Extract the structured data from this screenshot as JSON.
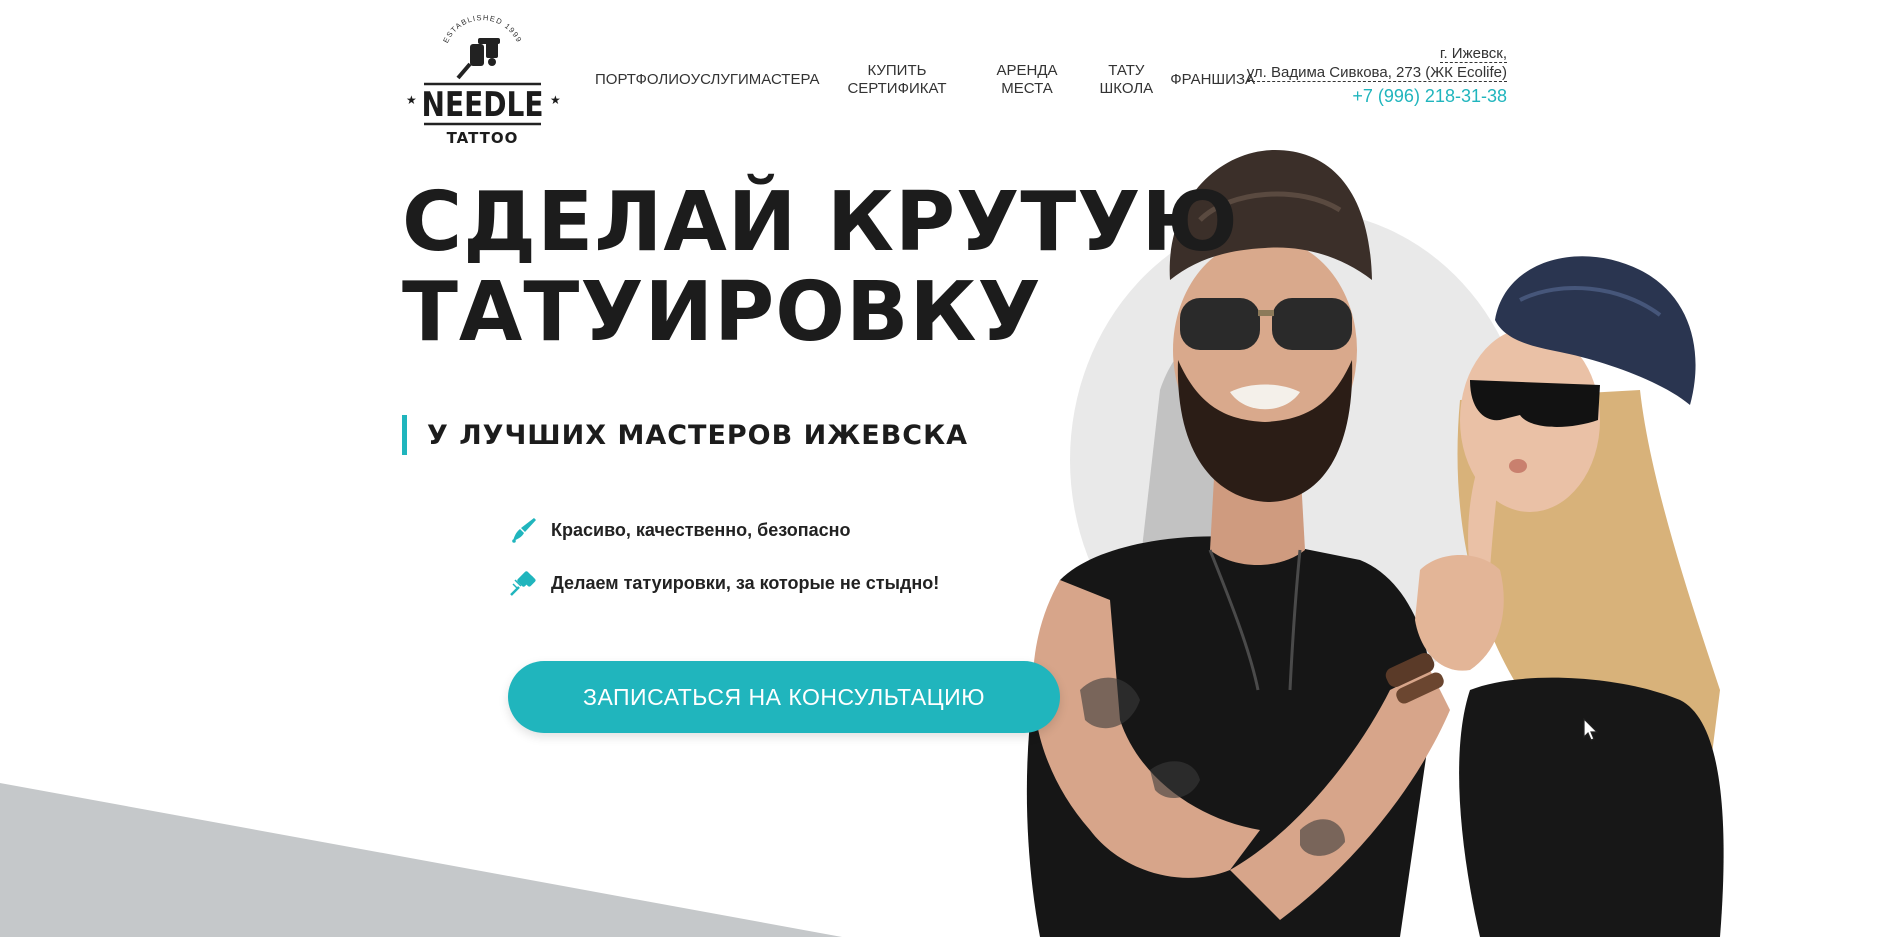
{
  "logo": {
    "established": "ESTABLISHED 1999",
    "name": "NEEDLE",
    "sub": "TATTOO"
  },
  "nav": {
    "items": [
      {
        "label": "ПОРТФОЛИО"
      },
      {
        "label": "УСЛУГИ"
      },
      {
        "label": "МАСТЕРА"
      },
      {
        "label_line1": "КУПИТЬ",
        "label_line2": "СЕРТИФИКАТ"
      },
      {
        "label_line1": "АРЕНДА",
        "label_line2": "МЕСТА"
      },
      {
        "label_line1": "ТАТУ",
        "label_line2": "ШКОЛА"
      },
      {
        "label": "ФРАНШИЗА"
      }
    ]
  },
  "contact": {
    "city": "г. Ижевск,",
    "street": "ул. Вадима Сивкова, 273 (ЖК Ecolife)",
    "phone": "+7 (996) 218-31-38"
  },
  "hero": {
    "headline_line1": "СДЕЛАЙ КРУТУЮ",
    "headline_line2": "ТАТУИРОВКУ",
    "subline": "У ЛУЧШИХ МАСТЕРОВ ИЖЕВСКА",
    "features": [
      {
        "icon": "brush-icon",
        "text": "Красиво, качественно, безопасно"
      },
      {
        "icon": "tattoo-machine-icon",
        "text": "Делаем татуировки, за которые не стыдно!"
      }
    ],
    "cta_label": "ЗАПИСАТЬСЯ НА КОНСУЛЬТАЦИЮ"
  },
  "colors": {
    "accent": "#20b5bd",
    "text": "#1c1c1c",
    "wedge": "#c5c8ca"
  }
}
